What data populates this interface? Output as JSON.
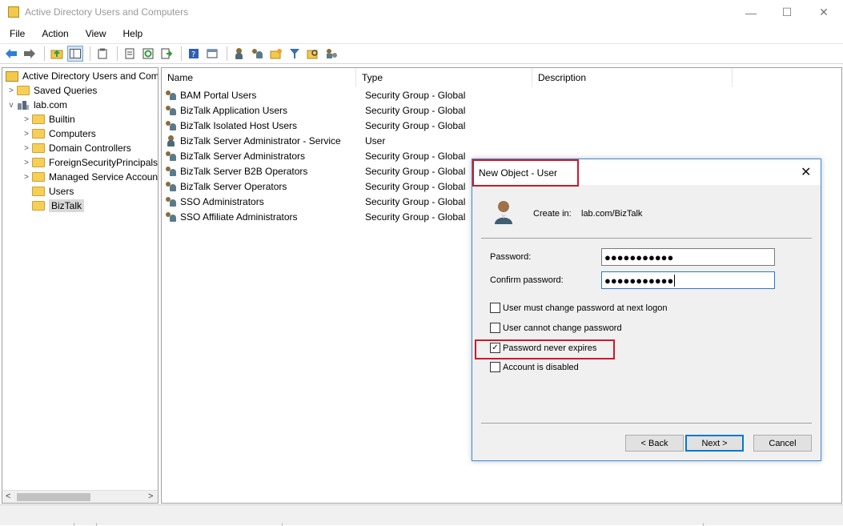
{
  "window": {
    "title": "Active Directory Users and Computers",
    "minimize_glyph": "—",
    "maximize_glyph": "☐",
    "close_glyph": "✕"
  },
  "menu": [
    "File",
    "Action",
    "View",
    "Help"
  ],
  "toolbar_icons": [
    "back-arrow-icon",
    "forward-arrow-icon",
    "up-folder-icon",
    "tree-pane-icon",
    "clipboard-icon",
    "properties-icon",
    "refresh-icon",
    "export-icon",
    "help-icon",
    "console-icon",
    "new-user-icon",
    "new-group-icon",
    "new-ou-icon",
    "filter-icon",
    "find-icon",
    "delegate-icon"
  ],
  "tree": {
    "root": "Active Directory Users and Com",
    "items": [
      {
        "label": "Saved Queries",
        "level": 1,
        "chevron": ">"
      },
      {
        "label": "lab.com",
        "level": 1,
        "chevron": "v"
      },
      {
        "label": "Builtin",
        "level": 2,
        "chevron": ">"
      },
      {
        "label": "Computers",
        "level": 2,
        "chevron": ">"
      },
      {
        "label": "Domain Controllers",
        "level": 2,
        "chevron": ">"
      },
      {
        "label": "ForeignSecurityPrincipals",
        "level": 2,
        "chevron": ">"
      },
      {
        "label": "Managed Service Accoun",
        "level": 2,
        "chevron": ">"
      },
      {
        "label": "Users",
        "level": 2,
        "chevron": ""
      },
      {
        "label": "BizTalk",
        "level": 2,
        "chevron": "",
        "selected": true
      }
    ],
    "scroll_left": "<",
    "scroll_right": ">"
  },
  "list": {
    "columns": [
      "Name",
      "Type",
      "Description"
    ],
    "rows": [
      {
        "name": "BAM Portal Users",
        "type": "Security Group - Global",
        "icon": "group"
      },
      {
        "name": "BizTalk Application Users",
        "type": "Security Group - Global",
        "icon": "group"
      },
      {
        "name": "BizTalk Isolated Host Users",
        "type": "Security Group - Global",
        "icon": "group"
      },
      {
        "name": "BizTalk Server Administrator - Service",
        "type": "User",
        "icon": "user"
      },
      {
        "name": "BizTalk Server Administrators",
        "type": "Security Group - Global",
        "icon": "group"
      },
      {
        "name": "BizTalk Server B2B Operators",
        "type": "Security Group - Global",
        "icon": "group"
      },
      {
        "name": "BizTalk Server Operators",
        "type": "Security Group - Global",
        "icon": "group"
      },
      {
        "name": "SSO Administrators",
        "type": "Security Group - Global",
        "icon": "group"
      },
      {
        "name": "SSO Affiliate Administrators",
        "type": "Security Group - Global",
        "icon": "group"
      }
    ]
  },
  "dialog": {
    "title": "New Object - User",
    "close_glyph": "✕",
    "create_in_label": "Create in:",
    "create_in_value": "lab.com/BizTalk",
    "password_label": "Password:",
    "password_value": "●●●●●●●●●●●",
    "confirm_label": "Confirm password:",
    "confirm_value": "●●●●●●●●●●●",
    "options": [
      {
        "label": "User must change password at next logon",
        "checked": false
      },
      {
        "label": "User cannot change password",
        "checked": false
      },
      {
        "label": "Password never expires",
        "checked": true
      },
      {
        "label": "Account is disabled",
        "checked": false
      }
    ],
    "check_glyph": "✓",
    "back_label": "< Back",
    "next_label": "Next >",
    "cancel_label": "Cancel"
  },
  "colors": {
    "highlight_red": "#d0182a",
    "dialog_border": "#3c8fd6",
    "default_button_border": "#0078d7"
  }
}
